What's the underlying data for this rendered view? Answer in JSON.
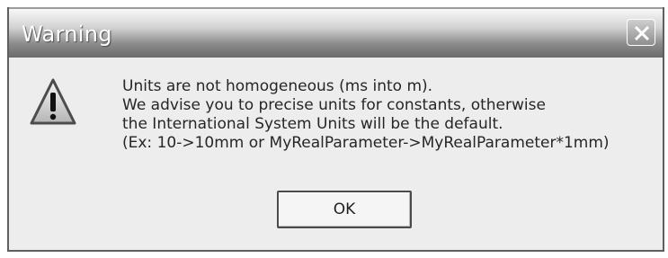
{
  "window": {
    "title": "Warning",
    "close_icon": "close-icon"
  },
  "message": {
    "icon": "warning-icon",
    "lines": [
      "Units are not homogeneous (ms into m).",
      "We advise you to precise units for constants, otherwise",
      "the International System Units will be the default.",
      "(Ex: 10->10mm or MyRealParameter->MyRealParameter*1mm)"
    ]
  },
  "buttons": {
    "ok_label": "OK"
  }
}
